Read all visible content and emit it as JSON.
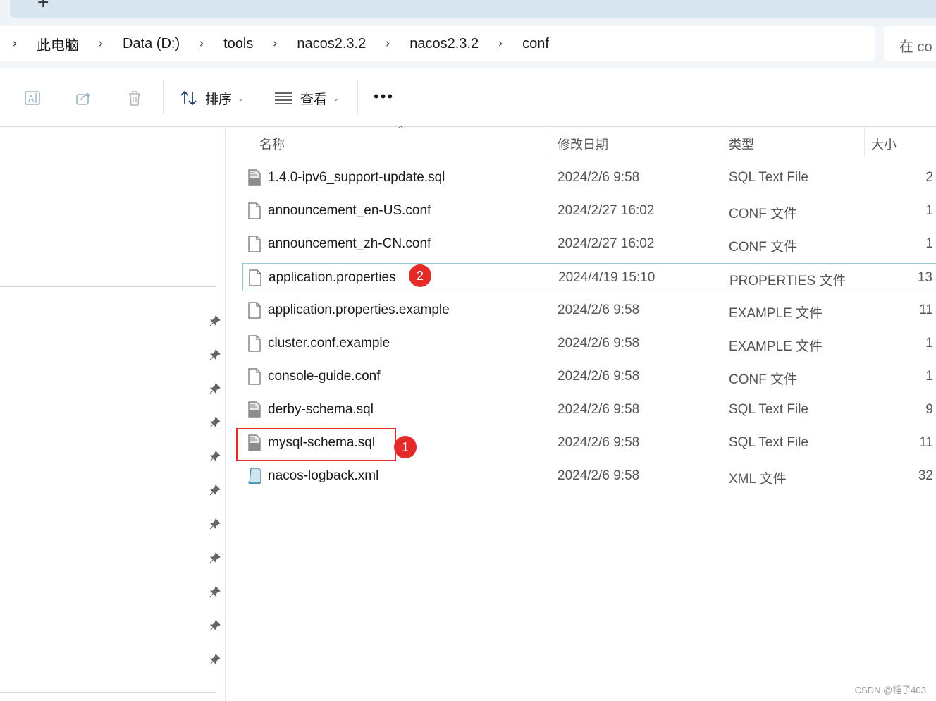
{
  "tab": {
    "new_tab_glyph": "+"
  },
  "address_bar": {
    "crumbs": [
      "此电脑",
      "Data (D:)",
      "tools",
      "nacos2.3.2",
      "nacos2.3.2",
      "conf"
    ],
    "chevron": "›"
  },
  "search": {
    "placeholder": "在 co"
  },
  "toolbar": {
    "sort_label": "排序",
    "view_label": "查看",
    "more_label": "•••",
    "icons": [
      "rename-icon",
      "share-icon",
      "delete-icon",
      "sort-icon",
      "view-icon",
      "more-icon"
    ]
  },
  "columns": {
    "name": "名称",
    "modified": "修改日期",
    "type": "类型",
    "size": "大小"
  },
  "files": [
    {
      "name": "1.4.0-ipv6_support-update.sql",
      "date": "2024/2/6 9:58",
      "type": "SQL Text File",
      "size": "2",
      "icon": "sql-file-icon"
    },
    {
      "name": "announcement_en-US.conf",
      "date": "2024/2/27 16:02",
      "type": "CONF 文件",
      "size": "1",
      "icon": "file-icon"
    },
    {
      "name": "announcement_zh-CN.conf",
      "date": "2024/2/27 16:02",
      "type": "CONF 文件",
      "size": "1",
      "icon": "file-icon"
    },
    {
      "name": "application.properties",
      "date": "2024/4/19 15:10",
      "type": "PROPERTIES 文件",
      "size": "13",
      "icon": "file-icon"
    },
    {
      "name": "application.properties.example",
      "date": "2024/2/6 9:58",
      "type": "EXAMPLE 文件",
      "size": "11",
      "icon": "file-icon"
    },
    {
      "name": "cluster.conf.example",
      "date": "2024/2/6 9:58",
      "type": "EXAMPLE 文件",
      "size": "1",
      "icon": "file-icon"
    },
    {
      "name": "console-guide.conf",
      "date": "2024/2/6 9:58",
      "type": "CONF 文件",
      "size": "1",
      "icon": "file-icon"
    },
    {
      "name": "derby-schema.sql",
      "date": "2024/2/6 9:58",
      "type": "SQL Text File",
      "size": "9",
      "icon": "sql-file-icon"
    },
    {
      "name": "mysql-schema.sql",
      "date": "2024/2/6 9:58",
      "type": "SQL Text File",
      "size": "11",
      "icon": "sql-file-icon"
    },
    {
      "name": "nacos-logback.xml",
      "date": "2024/2/6 9:58",
      "type": "XML 文件",
      "size": "32",
      "icon": "xml-file-icon"
    }
  ],
  "annotations": {
    "badge_1": "1",
    "badge_2": "2"
  },
  "watermark": "CSDN @锤子403",
  "colors": {
    "badge": "#e52a2a",
    "selection_border": "#99c6d6"
  }
}
